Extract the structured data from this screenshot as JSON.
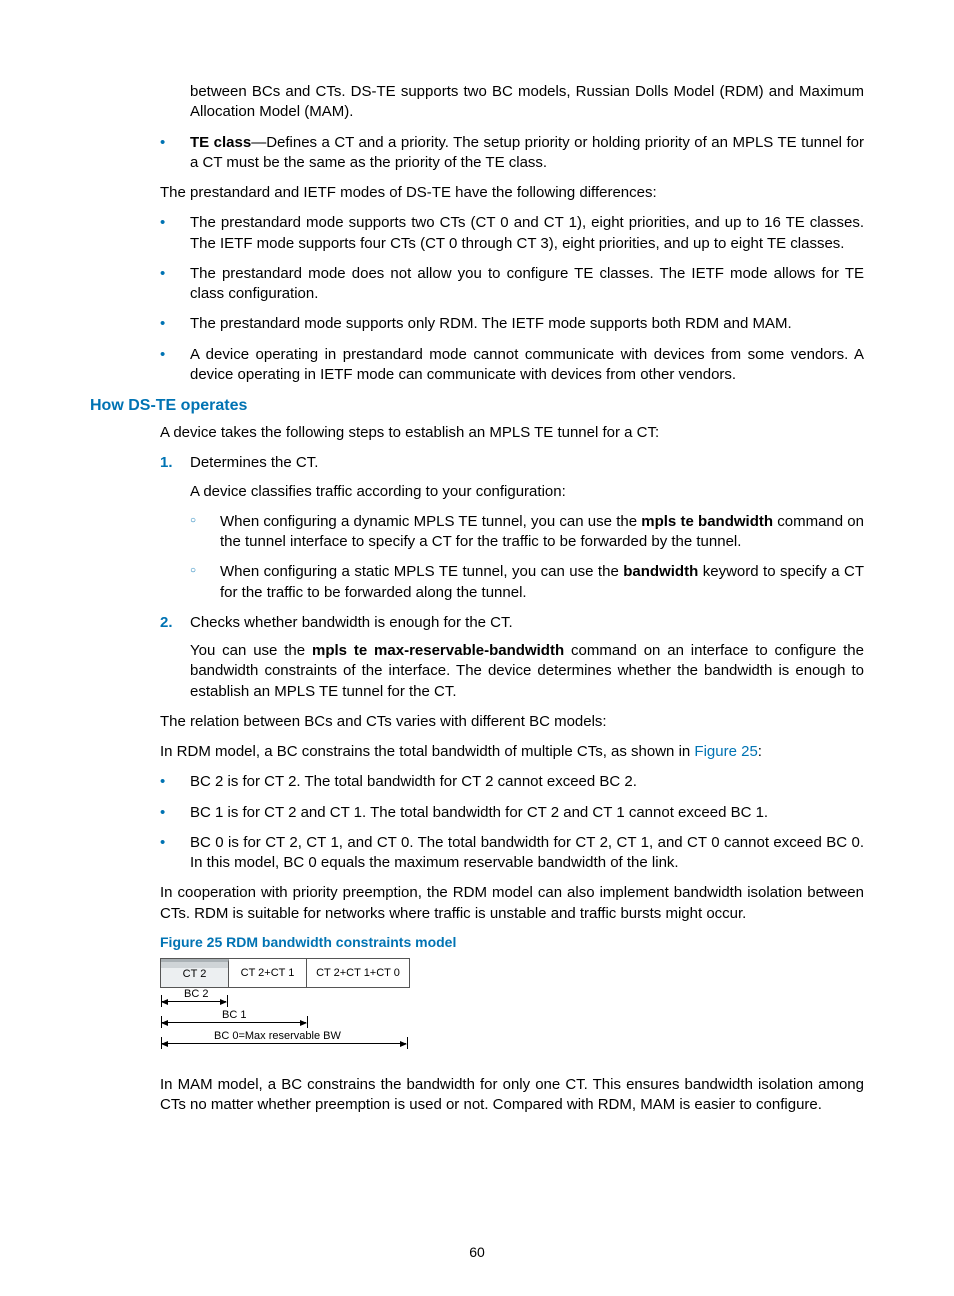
{
  "page_number": "60",
  "p_intro_tail": "between BCs and CTs. DS-TE supports two BC models, Russian Dolls Model (RDM) and Maximum Allocation Model (MAM).",
  "te_term": "TE class",
  "te_def": "—Defines a CT and a priority. The setup priority or holding priority of an MPLS TE tunnel for a CT must be the same as the priority of the TE class.",
  "p_modes": "The prestandard and IETF modes of DS-TE have the following differences:",
  "diff1": "The prestandard mode supports two CTs (CT 0 and CT 1), eight priorities, and up to 16 TE classes. The IETF mode supports four CTs (CT 0 through CT 3), eight priorities, and up to eight TE classes.",
  "diff2": "The prestandard mode does not allow you to configure TE classes. The IETF mode allows for TE class configuration.",
  "diff3": "The prestandard mode supports only RDM. The IETF mode supports both RDM and MAM.",
  "diff4": "A device operating in prestandard mode cannot communicate with devices from some vendors. A device operating in IETF mode can communicate with devices from other vendors.",
  "h_how": "How DS-TE operates",
  "p_steps": "A device takes the following steps to establish an MPLS TE tunnel for a CT:",
  "step1": "Determines the CT.",
  "step1_sub": "A device classifies traffic according to your configuration:",
  "s1o1a": "When configuring a dynamic MPLS TE tunnel, you can use the ",
  "s1o1b": "mpls te bandwidth",
  "s1o1c": " command on the tunnel interface to specify a CT for the traffic to be forwarded by the tunnel.",
  "s1o2a": "When configuring a static MPLS TE tunnel, you can use the ",
  "s1o2b": "bandwidth",
  "s1o2c": " keyword to specify a CT for the traffic to be forwarded along the tunnel.",
  "step2": "Checks whether bandwidth is enough for the CT.",
  "step2_suba": "You can use the ",
  "step2_subb": "mpls te max-reservable-bandwidth",
  "step2_subc": " command on an interface to configure the bandwidth constraints of the interface. The device determines whether the bandwidth is enough to establish an MPLS TE tunnel for the CT.",
  "p_rel": "The relation between BCs and CTs varies with different BC models:",
  "p_rdm_a": "In RDM model, a BC constrains the total bandwidth of multiple CTs, as shown in ",
  "p_rdm_fig": "Figure 25",
  "p_rdm_b": ":",
  "rdm1": "BC 2 is for CT 2. The total bandwidth for CT 2 cannot exceed BC 2.",
  "rdm2": "BC 1 is for CT 2 and CT 1. The total bandwidth for CT 2 and CT 1 cannot exceed BC 1.",
  "rdm3": "BC 0 is for CT 2, CT 1, and CT 0. The total bandwidth for CT 2, CT 1, and CT 0 cannot exceed BC 0. In this model, BC 0 equals the maximum reservable bandwidth of the link.",
  "p_coop": "In cooperation with priority preemption, the RDM model can also implement bandwidth isolation between CTs. RDM is suitable for networks where traffic is unstable and traffic bursts might occur.",
  "figcap": "Figure 25 RDM bandwidth constraints model",
  "fig": {
    "cell1": "CT 2",
    "cell2": "CT 2+CT 1",
    "cell3": "CT 2+CT 1+CT 0",
    "bc2": "BC 2",
    "bc1": "BC 1",
    "bc0": "BC 0=Max reservable BW"
  },
  "p_mam": "In MAM model, a BC constrains the bandwidth for only one CT. This ensures bandwidth isolation among CTs no matter whether preemption is used or not. Compared with RDM, MAM is easier to configure."
}
